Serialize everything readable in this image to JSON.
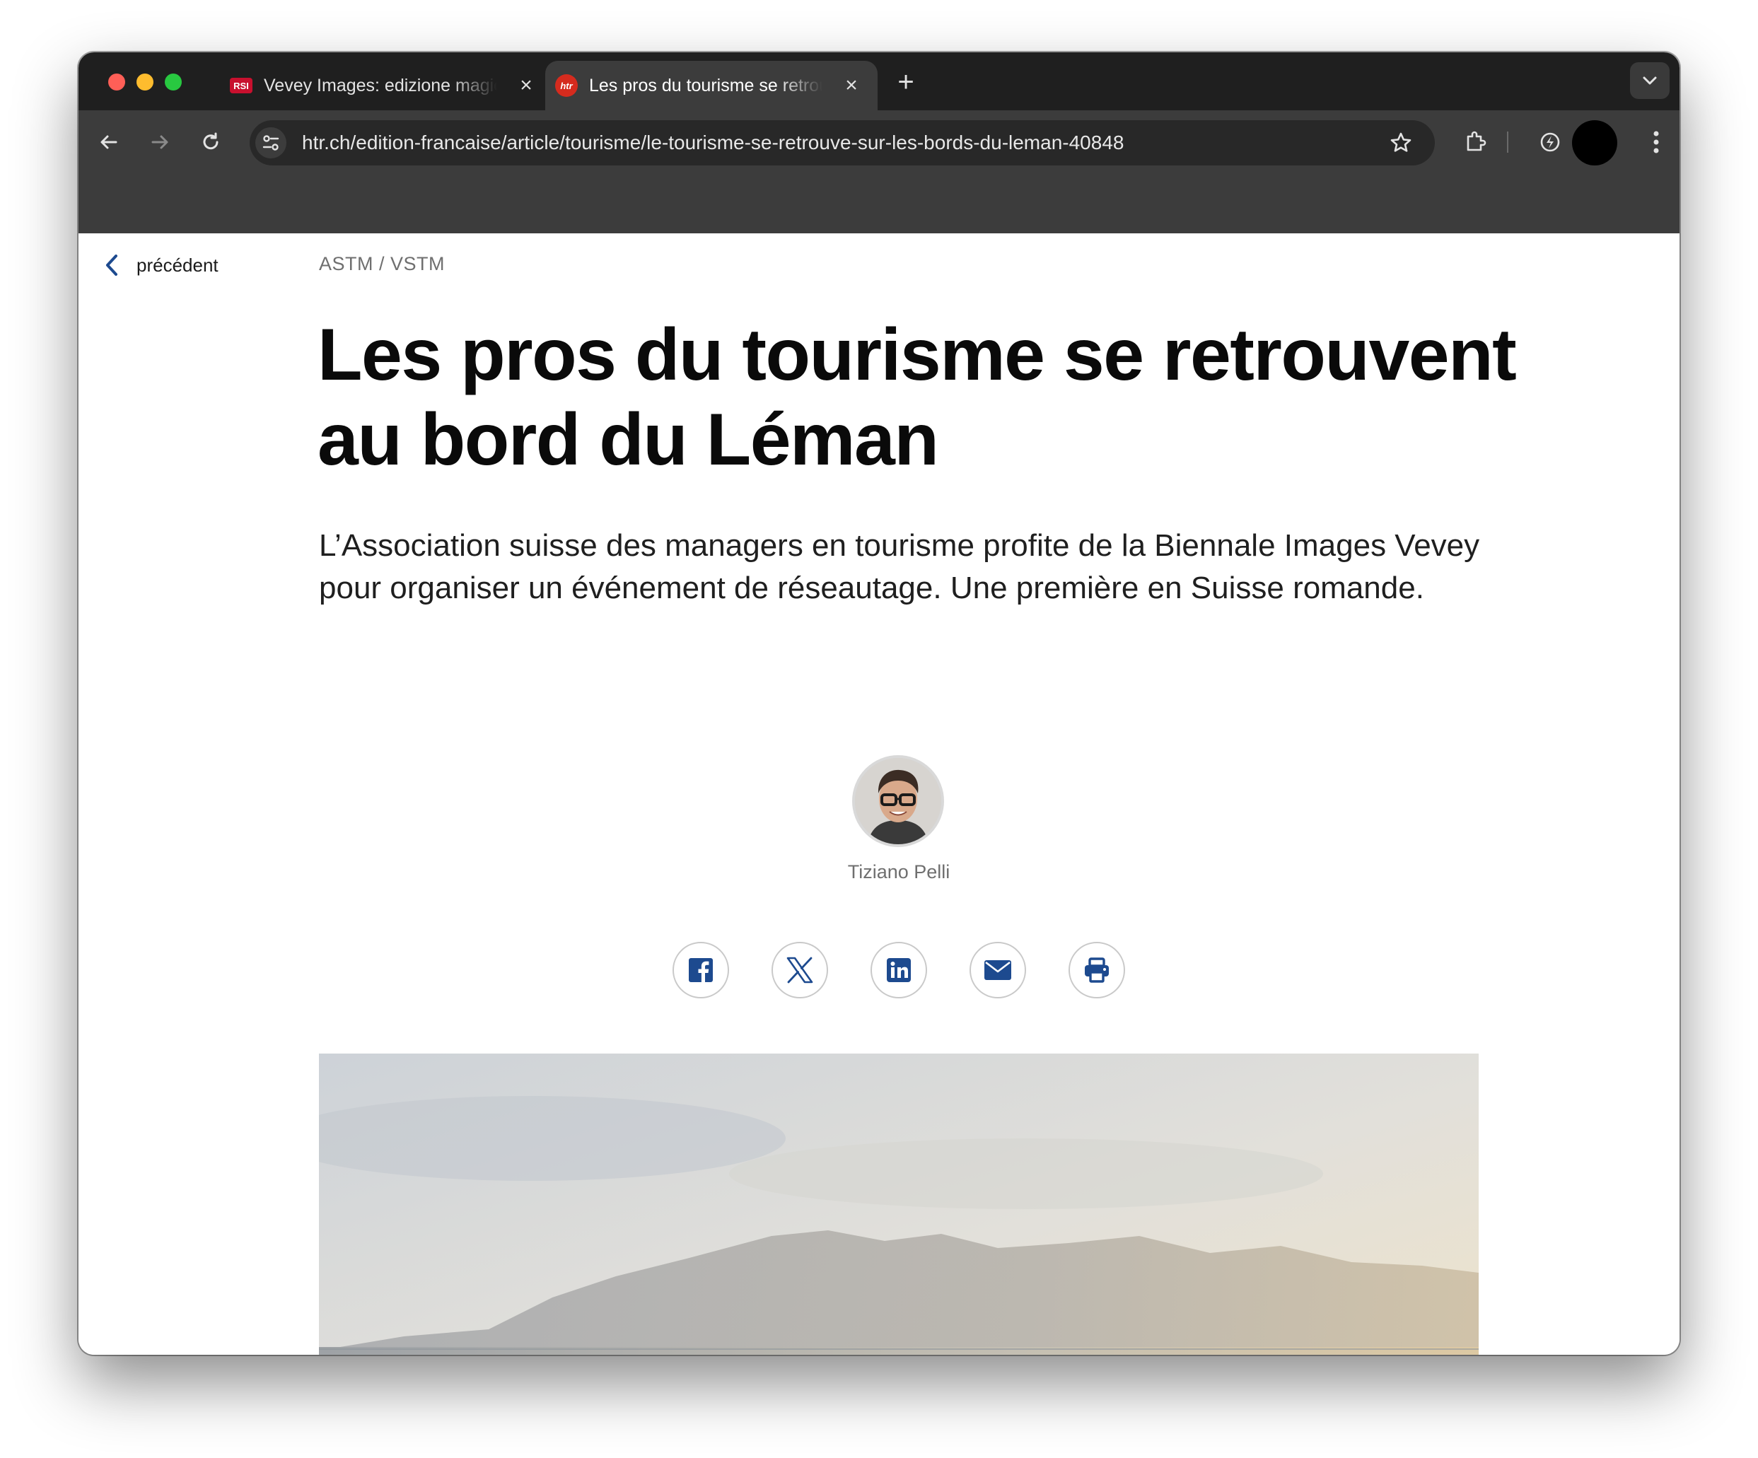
{
  "browser": {
    "tabs": [
      {
        "favicon": "RSI",
        "title": "Vevey Images: edizione magica",
        "active": false
      },
      {
        "favicon": "htr",
        "title": "Les pros du tourisme se retrouvent",
        "active": true
      }
    ],
    "new_tab": "+",
    "url": "htr.ch/edition-francaise/article/tourisme/le-tourisme-se-retrouve-sur-les-bords-du-leman-40848",
    "icons": [
      "back-icon",
      "forward-icon",
      "reload-icon",
      "site-info-icon",
      "bookmark-star-icon",
      "extensions-icon",
      "performance-icon",
      "profile-avatar",
      "menu-icon",
      "tab-search-icon"
    ]
  },
  "article": {
    "back_label": "précédent",
    "kicker": "ASTM / VSTM",
    "headline": "Les pros du tourisme se retrouvent au bord du Léman",
    "lead": "L’Association suisse des managers en tourisme profite de la Biennale Images Vevey pour organiser un événement de réseautage. Une première en Suisse romande.",
    "author": "Tiziano Pelli",
    "share": [
      "facebook-icon",
      "x-icon",
      "linkedin-icon",
      "email-icon",
      "print-icon"
    ],
    "brand_color": "#1d4a8f"
  }
}
